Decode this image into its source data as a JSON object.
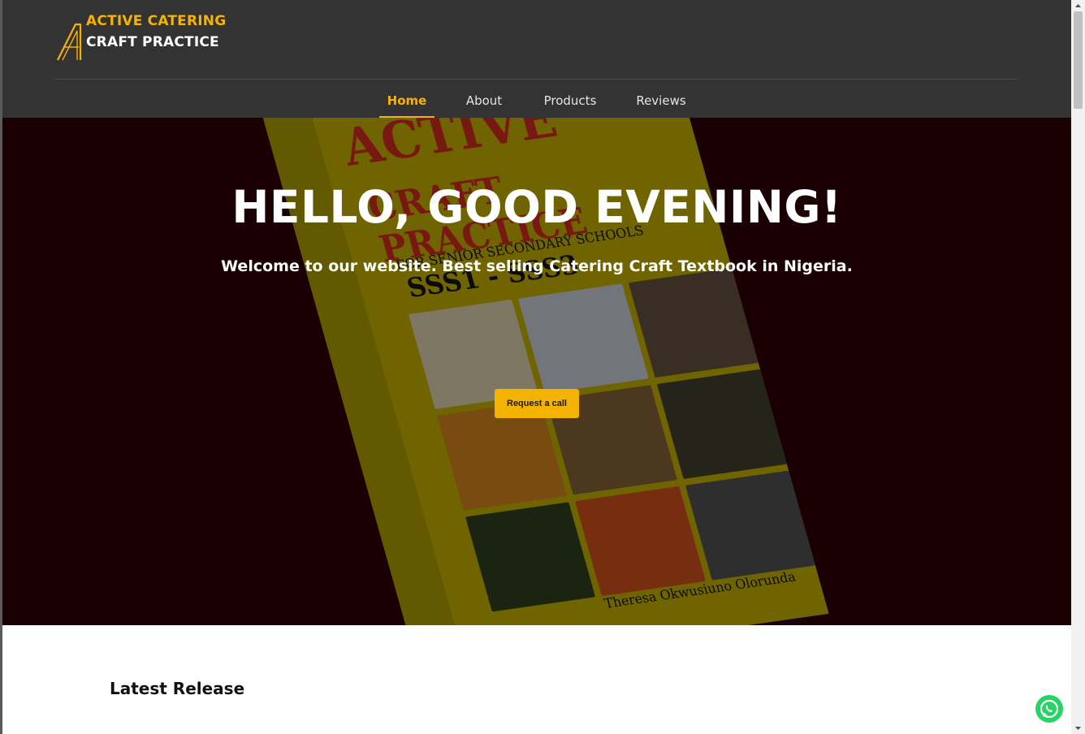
{
  "brand": {
    "line1": "ACTIVE CATERING",
    "line2": "CRAFT PRACTICE",
    "accent_color": "#f5b301"
  },
  "nav": {
    "items": [
      {
        "label": "Home",
        "active": true
      },
      {
        "label": "About",
        "active": false
      },
      {
        "label": "Products",
        "active": false
      },
      {
        "label": "Reviews",
        "active": false
      }
    ]
  },
  "hero": {
    "title": "HELLO, GOOD EVENING!",
    "subtitle": "Welcome to our website. Best selling Catering Craft Textbook in Nigeria.",
    "cta_label": "Request a call",
    "book": {
      "title_line1": "ACTIVE",
      "title_line2": "CRAFT PRACTICE",
      "subheading": "FOR SENIOR SECONDARY SCHOOLS",
      "levels": "SSS1 - SSS3",
      "author": "Theresa Okwusiuno Olorunda"
    }
  },
  "sections": {
    "latest_title": "Latest Release"
  },
  "whatsapp": {
    "icon": "whatsapp-icon",
    "color": "#25d366"
  }
}
